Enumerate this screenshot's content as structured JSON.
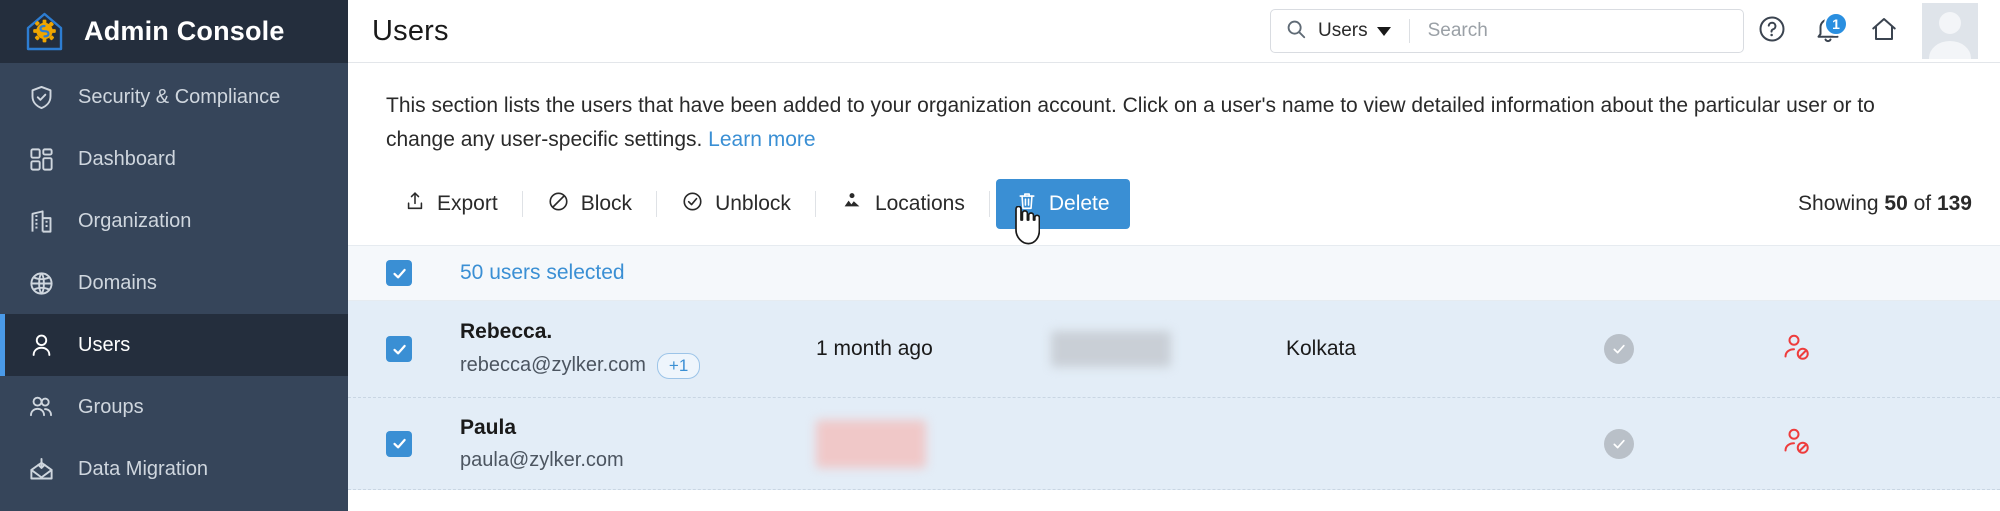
{
  "brand": {
    "title": "Admin Console",
    "logo_icon": "home-gear-logo-icon"
  },
  "sidebar": {
    "items": [
      {
        "label": "Security & Compliance",
        "icon": "shield-check-icon",
        "active": false
      },
      {
        "label": "Dashboard",
        "icon": "grid-dashboard-icon",
        "active": false
      },
      {
        "label": "Organization",
        "icon": "building-icon",
        "active": false
      },
      {
        "label": "Domains",
        "icon": "globe-icon",
        "active": false
      },
      {
        "label": "Users",
        "icon": "user-icon",
        "active": true
      },
      {
        "label": "Groups",
        "icon": "users-group-icon",
        "active": false
      },
      {
        "label": "Data Migration",
        "icon": "envelope-download-icon",
        "active": false
      }
    ]
  },
  "header": {
    "title": "Users",
    "search": {
      "scope": "Users",
      "placeholder": "Search",
      "value": "",
      "search_icon": "search-icon",
      "caret_icon": "chevron-down-icon"
    },
    "help_icon": "help-circle-icon",
    "notifications": {
      "icon": "bell-icon",
      "badge": "1"
    },
    "home_icon": "home-icon",
    "avatar_icon": "user-avatar-icon"
  },
  "description": {
    "text_before_link": "This section lists the users that have been added to your organization account. Click on a user's name to view detailed information about the particular user or to change any user-specific settings. ",
    "link": "Learn more"
  },
  "toolbar": {
    "export_label": "Export",
    "export_icon": "export-upload-icon",
    "block_label": "Block",
    "block_icon": "block-circle-icon",
    "unblock_label": "Unblock",
    "unblock_icon": "check-circle-icon",
    "locations_label": "Locations",
    "locations_icon": "locations-people-icon",
    "delete_label": "Delete",
    "delete_icon": "trash-icon",
    "showing_prefix": "Showing ",
    "showing_count": "50",
    "showing_middle": " of ",
    "showing_total": "139"
  },
  "selection_bar": {
    "checked": true,
    "label": "50 users selected",
    "checkbox_icon": "checkbox-checked-icon"
  },
  "rows": [
    {
      "checked": true,
      "checkbox_icon": "checkbox-checked-icon",
      "name": "Rebecca.",
      "email": "rebecca@zylker.com",
      "alias_badge": "+1",
      "last_active": "1 month ago",
      "masked_field": "",
      "masked_color": "#c9cfd6",
      "city": "Kolkata",
      "status_icon": "check-circle-filled-icon",
      "action_icon": "user-blocked-icon",
      "action_color": "#ee3c3c"
    },
    {
      "checked": true,
      "checkbox_icon": "checkbox-checked-icon",
      "name": "Paula",
      "email": "paula@zylker.com",
      "alias_badge": "",
      "last_active": "",
      "masked_field": "",
      "masked_color": "#f0c8c8",
      "city": "",
      "status_icon": "check-circle-filled-icon",
      "action_icon": "user-blocked-icon",
      "action_color": "#ee3c3c"
    }
  ],
  "colors": {
    "sidebar_bg": "#36455a",
    "sidebar_active_bg": "#242e3d",
    "accent_blue": "#3a8fd4",
    "row_selected_bg": "#e3edf7",
    "select_bar_bg": "#f5f8fb",
    "danger_red": "#ee3c3c"
  },
  "cursor": {
    "type": "pointing-hand"
  }
}
